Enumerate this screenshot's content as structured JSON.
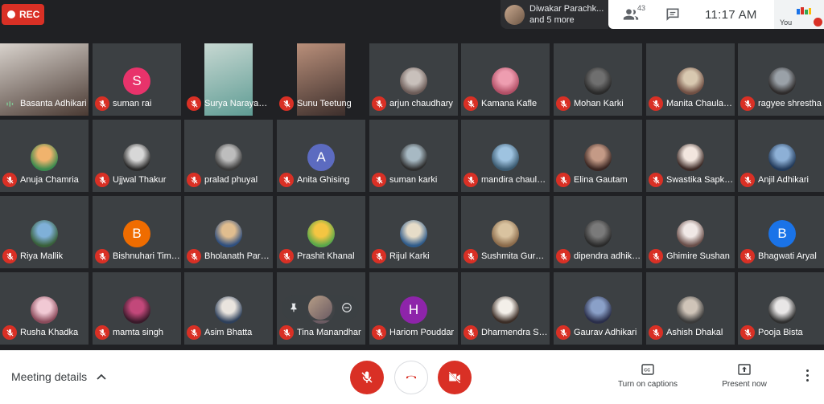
{
  "recording": {
    "label": "REC"
  },
  "presenter": {
    "name": "Diwakar Parachk...",
    "more": "and 5 more"
  },
  "topbar": {
    "people_count": "43",
    "time": "11:17 AM",
    "self_label": "You"
  },
  "participants": [
    {
      "name": "Basanta Adhikari",
      "type": "video",
      "muted": false,
      "speaking": true,
      "tone": [
        "#d8d2cc",
        "#4a3a33"
      ]
    },
    {
      "name": "suman rai",
      "type": "letter",
      "letter": "S",
      "color": "#e8336b",
      "muted": true
    },
    {
      "name": "Surya Narayan ...",
      "type": "video",
      "muted": true,
      "tone": [
        "#c7d8d2",
        "#5f9c94"
      ]
    },
    {
      "name": "Sunu Teetung",
      "type": "video",
      "muted": true,
      "tone": [
        "#b98f7a",
        "#3d2f2c"
      ]
    },
    {
      "name": "arjun chaudhary",
      "type": "photo",
      "muted": true,
      "tone": [
        "#c8c0bb",
        "#6b5b57"
      ]
    },
    {
      "name": "Kamana Kafle",
      "type": "photo",
      "muted": true,
      "tone": [
        "#ee9db0",
        "#b24f66"
      ]
    },
    {
      "name": "Mohan Karki",
      "type": "photo",
      "muted": true,
      "tone": [
        "#6f6f6f",
        "#2a2a2a"
      ]
    },
    {
      "name": "Manita Chaulag...",
      "type": "photo",
      "muted": true,
      "tone": [
        "#d8c8b0",
        "#704f43"
      ]
    },
    {
      "name": "ragyee shrestha",
      "type": "photo",
      "muted": true,
      "tone": [
        "#9aa1a8",
        "#2e2b2b"
      ]
    },
    {
      "name": "Anuja Chamria",
      "type": "photo",
      "muted": true,
      "tone": [
        "#f0b36d",
        "#3b8a4e"
      ]
    },
    {
      "name": "Ujjwal Thakur",
      "type": "photo",
      "muted": true,
      "tone": [
        "#d7d7d7",
        "#2b2b2b"
      ]
    },
    {
      "name": "pralad phuyal",
      "type": "photo",
      "muted": true,
      "tone": [
        "#bdbdbd",
        "#3a3a3a"
      ]
    },
    {
      "name": "Anita Ghising",
      "type": "letter",
      "letter": "A",
      "color": "#5c6bc0",
      "muted": true
    },
    {
      "name": "suman karki",
      "type": "photo",
      "muted": true,
      "tone": [
        "#a7b9c3",
        "#2d2d2d"
      ]
    },
    {
      "name": "mandira chaula...",
      "type": "photo",
      "muted": true,
      "tone": [
        "#9ec3e0",
        "#3b5a70"
      ]
    },
    {
      "name": "Elina Gautam",
      "type": "photo",
      "muted": true,
      "tone": [
        "#c49a86",
        "#3a2622"
      ]
    },
    {
      "name": "Swastika Sapko...",
      "type": "photo",
      "muted": true,
      "tone": [
        "#f2e6df",
        "#3c2a26"
      ]
    },
    {
      "name": "Anjil Adhikari",
      "type": "photo",
      "muted": true,
      "tone": [
        "#8db0d6",
        "#223a5a"
      ]
    },
    {
      "name": "Riya Mallik",
      "type": "photo",
      "muted": true,
      "tone": [
        "#7fb0d8",
        "#39603a"
      ]
    },
    {
      "name": "Bishnuhari Timi...",
      "type": "letter",
      "letter": "B",
      "color": "#ef6c00",
      "muted": true
    },
    {
      "name": "Bholanath Paraj...",
      "type": "photo",
      "muted": true,
      "tone": [
        "#e0bd8f",
        "#2f4f7f"
      ]
    },
    {
      "name": "Prashit Khanal",
      "type": "photo",
      "muted": true,
      "tone": [
        "#f4c542",
        "#5aa84a"
      ]
    },
    {
      "name": "Rijul Karki",
      "type": "photo",
      "muted": true,
      "tone": [
        "#e6dcc8",
        "#2f5b8a"
      ]
    },
    {
      "name": "Sushmita Gurung",
      "type": "photo",
      "muted": true,
      "tone": [
        "#d9c3a0",
        "#8a6a4a"
      ]
    },
    {
      "name": "dipendra adhika...",
      "type": "photo",
      "muted": true,
      "tone": [
        "#7a7a7a",
        "#2a2a2a"
      ]
    },
    {
      "name": "Ghimire Sushan",
      "type": "photo",
      "muted": true,
      "tone": [
        "#f0e8e6",
        "#6a4f4a"
      ]
    },
    {
      "name": "Bhagwati Aryal",
      "type": "letter",
      "letter": "B",
      "color": "#1a73e8",
      "muted": true
    },
    {
      "name": "Rusha Khadka",
      "type": "photo",
      "muted": true,
      "tone": [
        "#f1c9d4",
        "#8a4a5a"
      ]
    },
    {
      "name": "mamta singh",
      "type": "photo",
      "muted": true,
      "tone": [
        "#c2487a",
        "#3a1a2a"
      ]
    },
    {
      "name": "Asim Bhatta",
      "type": "photo",
      "muted": true,
      "tone": [
        "#e9e4de",
        "#2d3f5a"
      ]
    },
    {
      "name": "Tina Manandhar",
      "type": "photo",
      "muted": true,
      "tone": [
        "#b79e87",
        "#6a5a62"
      ]
    },
    {
      "name": "Hariom Pouddar",
      "type": "letter",
      "letter": "H",
      "color": "#8e24aa",
      "muted": true
    },
    {
      "name": "Dharmendra Sin...",
      "type": "photo",
      "muted": true,
      "tone": [
        "#f3efe9",
        "#3b2d26"
      ]
    },
    {
      "name": "Gaurav Adhikari",
      "type": "photo",
      "muted": true,
      "tone": [
        "#8aa0c8",
        "#2a2e4a"
      ]
    },
    {
      "name": "Ashish Dhakal",
      "type": "photo",
      "muted": true,
      "tone": [
        "#cfc4b8",
        "#3a3a3a"
      ]
    },
    {
      "name": "Pooja Bista",
      "type": "photo",
      "muted": true,
      "tone": [
        "#e8e6e6",
        "#2f2f2f"
      ]
    }
  ],
  "bottombar": {
    "meeting_details": "Meeting details",
    "captions": "Turn on captions",
    "present": "Present now"
  },
  "colors": {
    "danger": "#d93025",
    "background": "#202124",
    "tile": "#3c4043",
    "speaking": "#81c995"
  }
}
